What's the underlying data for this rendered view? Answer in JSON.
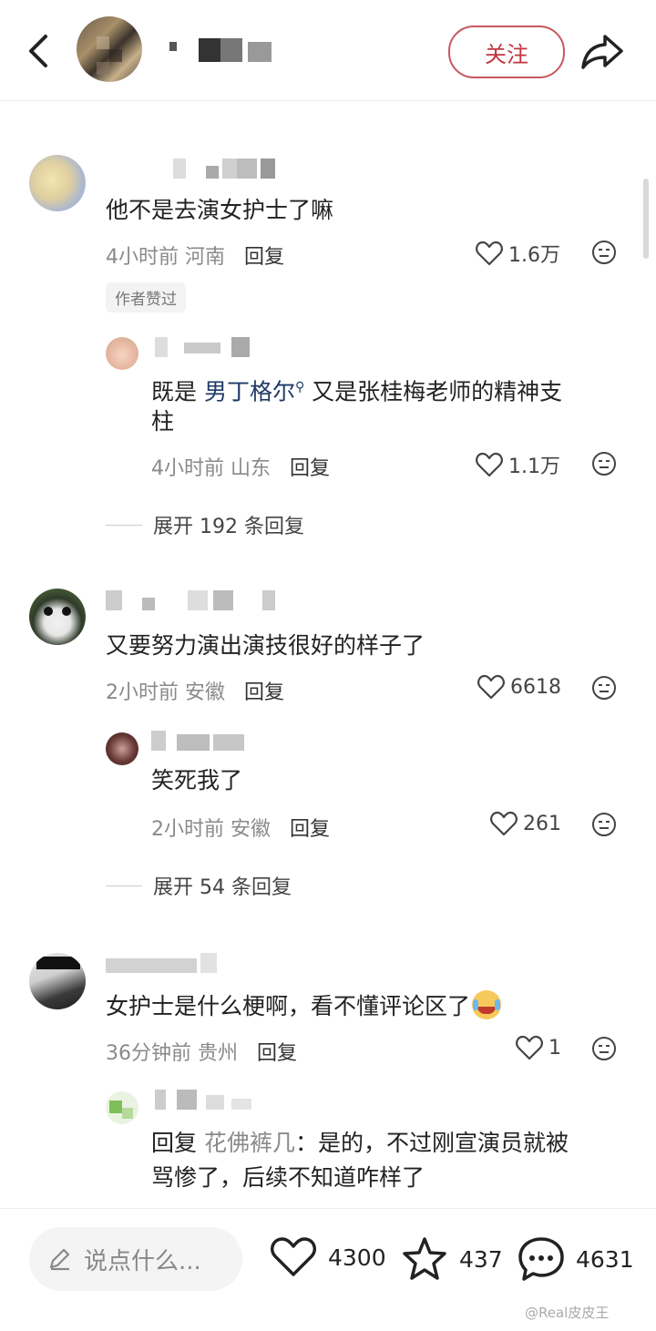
{
  "header": {
    "follow_label": "关注"
  },
  "comments": [
    {
      "text": "他不是去演女护士了嘛",
      "time": "4小时前",
      "location": "河南",
      "reply_label": "回复",
      "likes": "1.6万",
      "badge": "作者赞过",
      "replies": [
        {
          "text_line1_prefix": "既是 ",
          "link": "男丁格尔",
          "text_line1_suffix": " 又是张桂梅老师的精神支",
          "text_line2": "柱",
          "time": "4小时前",
          "location": "山东",
          "reply_label": "回复",
          "likes": "1.1万"
        }
      ],
      "expand_label": "展开 192 条回复"
    },
    {
      "text": "又要努力演出演技很好的样子了",
      "time": "2小时前",
      "location": "安徽",
      "reply_label": "回复",
      "likes": "6618",
      "replies": [
        {
          "text": "笑死我了",
          "time": "2小时前",
          "location": "安徽",
          "reply_label": "回复",
          "likes": "261"
        }
      ],
      "expand_label": "展开 54 条回复"
    },
    {
      "text": "女护士是什么梗啊，看不懂评论区了",
      "time": "36分钟前",
      "location": "贵州",
      "reply_label": "回复",
      "likes": "1",
      "replies": [
        {
          "reply_prefix": "回复",
          "reply_to": "花佛裤几",
          "text_line1": "：是的，不过刚宣演员就被",
          "text_line2": "骂惨了，后续不知道咋样了"
        }
      ]
    }
  ],
  "bottom": {
    "placeholder": "说点什么...",
    "likes": "4300",
    "favorites": "437",
    "comments": "4631"
  },
  "watermark": "@Real皮皮王"
}
